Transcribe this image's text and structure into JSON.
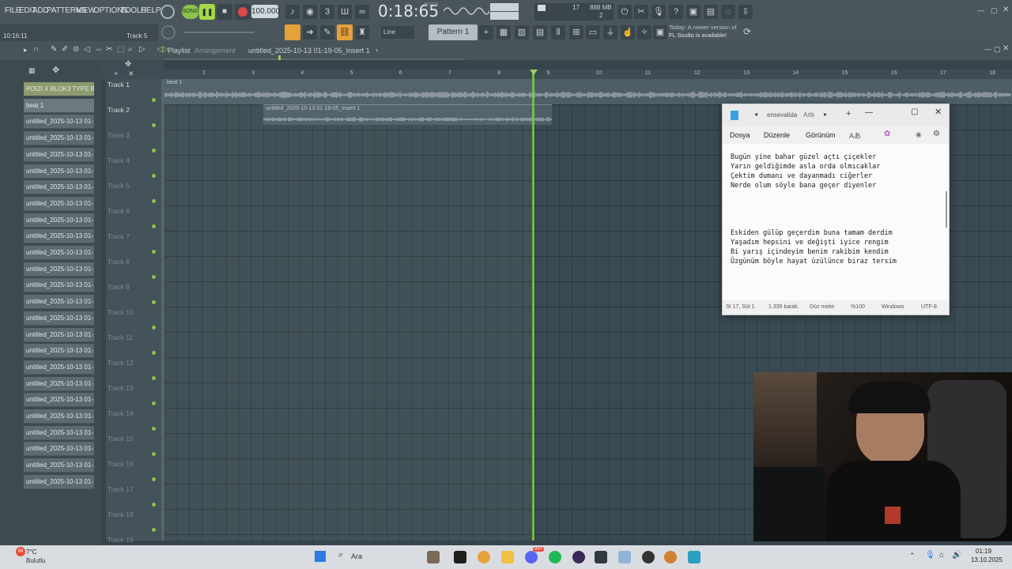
{
  "menu": [
    "FILE",
    "EDIT",
    "ADD",
    "PATTERNS",
    "VIEW",
    "OPTIONS",
    "TOOLS",
    "HELP"
  ],
  "transport": {
    "mode": "SONG",
    "tempo": "100.000",
    "time": "0:18:65",
    "time_unit": "M:S:CS",
    "cpu": "17",
    "memory": "888 MB",
    "voices": "2"
  },
  "hint_bar": {
    "time": "10:16:11",
    "track": "Track 5"
  },
  "snap": "Line",
  "pattern": "Pattern 1",
  "update_notice": {
    "line1": "Today: A newer version of",
    "line2": "FL Studio is available!"
  },
  "playlist": {
    "title": "Playlist",
    "subtitle": "Arrangement",
    "breadcrumb": "untitled_2025-10-13 01-19-05_Insert 1"
  },
  "browser_items": [
    "POIZI X BLOK3 TYPE B...",
    "beat 1",
    "untitled_2025-10-13 01-...",
    "untitled_2025-10-13 01-...",
    "untitled_2025-10-13 01-...",
    "untitled_2025-10-13 01-...",
    "untitled_2025-10-13 01-...",
    "untitled_2025-10-13 01-...",
    "untitled_2025-10-13 01-...",
    "untitled_2025-10-13 01-...",
    "untitled_2025-10-13 01-...",
    "untitled_2025-10-13 01-...",
    "untitled_2025-10-13 01-...",
    "untitled_2025-10-13 01-...",
    "untitled_2025-10-13 01-...",
    "untitled_2025-10-13 01-...",
    "untitled_2025-10-13 01-...",
    "untitled_2025-10-13 01-...",
    "untitled_2025-10-13 01-...",
    "untitled_2025-10-13 01-...",
    "untitled_2025-10-13 01-...",
    "untitled_2025-10-13 01-...",
    "untitled_2025-10-13 01-...",
    "untitled_2025-10-13 01-...",
    "untitled_2025-10-13 01-..."
  ],
  "tracks": [
    "Track 1",
    "Track 2",
    "Track 3",
    "Track 4",
    "Track 5",
    "Track 6",
    "Track 7",
    "Track 8",
    "Track 9",
    "Track 10",
    "Track 11",
    "Track 12",
    "Track 13",
    "Track 14",
    "Track 15",
    "Track 16",
    "Track 17",
    "Track 18",
    "Track 19"
  ],
  "ruler": [
    "2",
    "3",
    "4",
    "5",
    "6",
    "7",
    "8",
    "9",
    "10",
    "11",
    "12",
    "13",
    "14",
    "15",
    "16",
    "17",
    "18"
  ],
  "clips": {
    "beat": "beat 1",
    "insert": "untitled_2025-10-13 01-19-05_Insert 1"
  },
  "notepad": {
    "tab_title": "ensevalida",
    "tab_extra": "Artlı",
    "menu": [
      "Dosya",
      "Düzenle",
      "Görünüm"
    ],
    "lines1": [
      "Bugün yine bahar güzel açtı çiçekler",
      "Yarın geldiğimde asla orda olmıcaklar",
      "Çektim dumanı ve dayanmadı ciğerler",
      "Nerde olum söyle bana geçer diyenler"
    ],
    "lines2": [
      "Eskiden gülüp geçerdim buna tamam derdim",
      "Yaşadım hepsini ve değişti iyice rengim",
      "Bi yarış içindeyim benim rakibim kendim",
      "Üzgünüm böyle hayat üzülünce biraz tersim"
    ],
    "status": {
      "position": "St 17, Süt 1",
      "chars": "1.335 karak.",
      "format": "Düz metin",
      "zoom": "%100",
      "eol": "Windows",
      "encoding": "UTF-8"
    }
  },
  "taskbar": {
    "temperature": "7°C",
    "weather": "Bulutlu",
    "search": "Ara",
    "time": "01:19",
    "date": "13.10.2025",
    "badge": "99+",
    "notification": "99"
  },
  "colors": {
    "accent_green": "#7ccf3a",
    "panel": "#4a565c",
    "grid": "#394a52"
  }
}
